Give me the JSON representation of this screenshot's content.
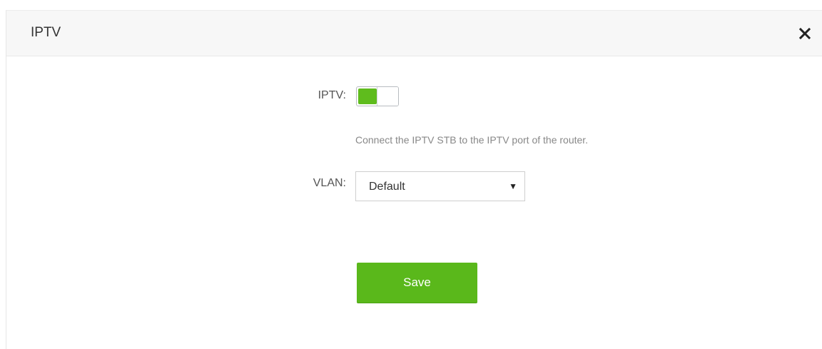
{
  "dialog": {
    "title": "IPTV",
    "close_icon": "close-icon"
  },
  "form": {
    "iptv_label": "IPTV:",
    "iptv_enabled": true,
    "hint": "Connect the IPTV STB to the IPTV port of the router.",
    "vlan_label": "VLAN:",
    "vlan_value": "Default",
    "save_label": "Save"
  },
  "colors": {
    "accent": "#5ab81b",
    "header_bg": "#f7f7f7"
  }
}
